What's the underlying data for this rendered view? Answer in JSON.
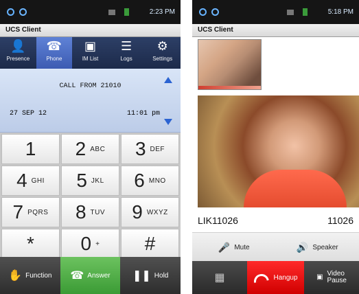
{
  "left": {
    "status": {
      "time": "2:23 PM"
    },
    "title": "UCS Client",
    "tabs": [
      {
        "label": "Presence",
        "icon": "person-icon"
      },
      {
        "label": "Phone",
        "icon": "phone-icon",
        "active": true
      },
      {
        "label": "IM List",
        "icon": "chat-icon"
      },
      {
        "label": "Logs",
        "icon": "list-icon"
      },
      {
        "label": "Settings",
        "icon": "gear-icon"
      }
    ],
    "call": {
      "from": "CALL FROM 21010",
      "date": "27 SEP 12",
      "time": "11:01 pm"
    },
    "keypad": [
      {
        "num": "1",
        "letters": ""
      },
      {
        "num": "2",
        "letters": "ABC"
      },
      {
        "num": "3",
        "letters": "DEF"
      },
      {
        "num": "4",
        "letters": "GHI"
      },
      {
        "num": "5",
        "letters": "JKL"
      },
      {
        "num": "6",
        "letters": "MNO"
      },
      {
        "num": "7",
        "letters": "PQRS"
      },
      {
        "num": "8",
        "letters": "TUV"
      },
      {
        "num": "9",
        "letters": "WXYZ"
      },
      {
        "num": "*",
        "letters": ""
      },
      {
        "num": "0",
        "letters": "+"
      },
      {
        "num": "#",
        "letters": ""
      }
    ],
    "bottom": {
      "function_label": "Function",
      "answer_label": "Answer",
      "hold_label": "Hold"
    }
  },
  "right": {
    "status": {
      "time": "5:18 PM"
    },
    "title": "UCS Client",
    "id_left": "LIK11026",
    "id_right": "11026",
    "controls": {
      "mute_label": "Mute",
      "speaker_label": "Speaker"
    },
    "bottom": {
      "hangup_label": "Hangup",
      "video_pause_label_line1": "Video",
      "video_pause_label_line2": "Pause"
    }
  },
  "colors": {
    "tab_bg": "#1c2a4a",
    "tab_active": "#3c5bb2",
    "answer_green": "#3b9b35",
    "hangup_red": "#d00000"
  }
}
